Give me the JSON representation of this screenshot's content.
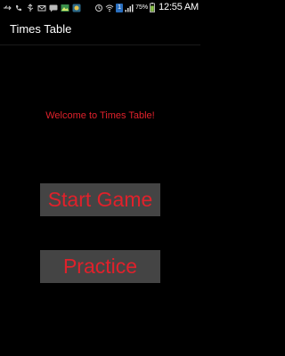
{
  "status_bar": {
    "time": "12:55 AM",
    "battery_percent": "75%",
    "notification_badge": "1",
    "left_icons": [
      "usb-icon",
      "phone-icon",
      "usb-icon",
      "email-icon",
      "chat-icon",
      "gallery-icon",
      "game-icon"
    ],
    "right_icons": [
      "signal-strength-icon",
      "wifi-icon",
      "sim-icon",
      "cell-signal-icon",
      "battery-icon"
    ]
  },
  "action_bar": {
    "title": "Times Table"
  },
  "main": {
    "welcome_text": "Welcome to Times Table!",
    "start_button_label": "Start Game",
    "practice_button_label": "Practice"
  },
  "colors": {
    "background": "#000000",
    "accent_text": "#e0212b",
    "button_background": "#444444",
    "title_text": "#ffffff"
  }
}
